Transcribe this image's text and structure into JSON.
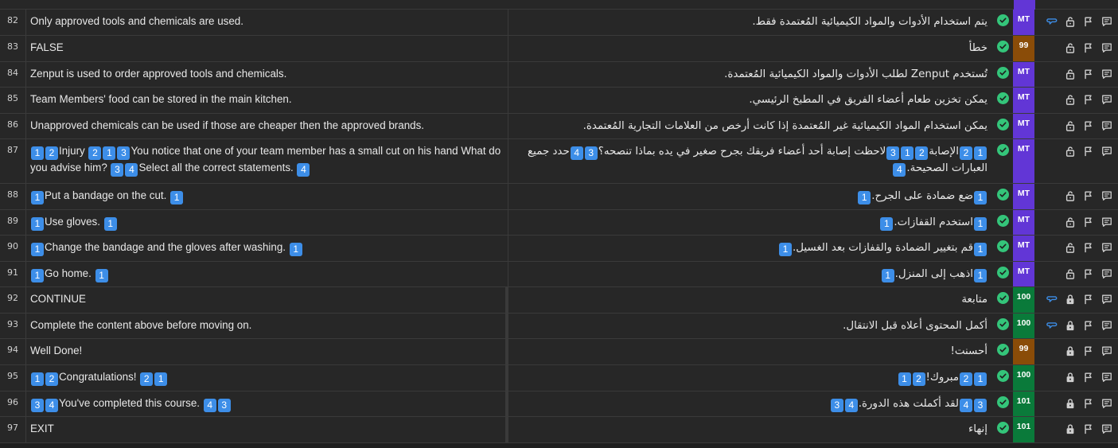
{
  "rows": [
    {
      "num": "82",
      "source": [
        {
          "t": "Only approved tools and chemicals are used."
        }
      ],
      "target": [
        {
          "t": "يتم استخدام الأدوات والمواد الكيميائية المُعتمدة فقط."
        }
      ],
      "badge": "MT",
      "badge_type": "mt",
      "status_icon": "check-circle-icon",
      "icons": [
        "comment-chain-icon",
        "lock-open-icon",
        "flag-icon",
        "comment-icon"
      ],
      "locked": false,
      "link": true
    },
    {
      "num": "83",
      "source": [
        {
          "t": "FALSE"
        }
      ],
      "target": [
        {
          "t": "خطأ"
        }
      ],
      "badge": "99",
      "badge_type": "99",
      "status_icon": "check-circle-icon",
      "icons": [
        "lock-open-icon",
        "flag-icon",
        "comment-icon"
      ],
      "locked": false,
      "link": false
    },
    {
      "num": "84",
      "source": [
        {
          "t": "Zenput is used to order approved tools and chemicals."
        }
      ],
      "target": [
        {
          "t": "تُستخدم Zenput لطلب الأدوات والمواد الكيميائية المُعتمدة."
        }
      ],
      "badge": "MT",
      "badge_type": "mt",
      "status_icon": "check-circle-icon",
      "icons": [
        "lock-open-icon",
        "flag-icon",
        "comment-icon"
      ],
      "locked": false,
      "link": false
    },
    {
      "num": "85",
      "source": [
        {
          "t": "Team Members' food can be stored in the main kitchen."
        }
      ],
      "target": [
        {
          "t": "يمكن تخزين طعام أعضاء الفريق في المطبخ الرئيسي."
        }
      ],
      "badge": "MT",
      "badge_type": "mt",
      "status_icon": "check-circle-icon",
      "icons": [
        "lock-open-icon",
        "flag-icon",
        "comment-icon"
      ],
      "locked": false,
      "link": false
    },
    {
      "num": "86",
      "source": [
        {
          "t": "Unapproved chemicals can be used if those are cheaper then the approved brands."
        }
      ],
      "target": [
        {
          "t": "يمكن استخدام المواد الكيميائية غير المُعتمدة إذا كانت أرخص من العلامات التجارية المُعتمدة."
        }
      ],
      "badge": "MT",
      "badge_type": "mt",
      "status_icon": "check-circle-icon",
      "icons": [
        "lock-open-icon",
        "flag-icon",
        "comment-icon"
      ],
      "locked": false,
      "link": false
    },
    {
      "num": "87",
      "source": [
        {
          "tag": "1"
        },
        {
          "tag": "2"
        },
        {
          "t": "Injury "
        },
        {
          "tag": "2"
        },
        {
          "tag": "1"
        },
        {
          "tag": "3"
        },
        {
          "t": "You notice that one of your team member has a small cut on his hand What do you advise him? "
        },
        {
          "tag": "3"
        },
        {
          "tag": "4"
        },
        {
          "t": "Select all the correct statements. "
        },
        {
          "tag": "4"
        }
      ],
      "target": [
        {
          "tag": "1"
        },
        {
          "tag": "2"
        },
        {
          "t": "الإصابة"
        },
        {
          "tag": "2"
        },
        {
          "tag": "1"
        },
        {
          "tag": "3"
        },
        {
          "t": "لاحظت إصابة أحد أعضاء فريقك بجرح صغير في يده بماذا تنصحه؟"
        },
        {
          "tag": "3"
        },
        {
          "tag": "4"
        },
        {
          "t": "حدد جميع العبارات الصحيحة."
        },
        {
          "tag": "4"
        }
      ],
      "badge": "MT",
      "badge_type": "mt",
      "status_icon": "check-circle-icon",
      "icons": [
        "lock-open-icon",
        "flag-icon",
        "comment-icon"
      ],
      "locked": false,
      "link": false,
      "tall": true
    },
    {
      "num": "88",
      "source": [
        {
          "tag": "1"
        },
        {
          "t": "Put a bandage on the cut. "
        },
        {
          "tag": "1"
        }
      ],
      "target": [
        {
          "tag": "1"
        },
        {
          "t": "ضع ضمادة على الجرح."
        },
        {
          "tag": "1"
        }
      ],
      "badge": "MT",
      "badge_type": "mt",
      "status_icon": "check-circle-icon",
      "icons": [
        "lock-open-icon",
        "flag-icon",
        "comment-icon"
      ],
      "locked": false,
      "link": false
    },
    {
      "num": "89",
      "source": [
        {
          "tag": "1"
        },
        {
          "t": "Use gloves. "
        },
        {
          "tag": "1"
        }
      ],
      "target": [
        {
          "tag": "1"
        },
        {
          "t": "استخدم القفازات."
        },
        {
          "tag": "1"
        }
      ],
      "badge": "MT",
      "badge_type": "mt",
      "status_icon": "check-circle-icon",
      "icons": [
        "lock-open-icon",
        "flag-icon",
        "comment-icon"
      ],
      "locked": false,
      "link": false
    },
    {
      "num": "90",
      "source": [
        {
          "tag": "1"
        },
        {
          "t": "Change the bandage and the gloves after washing. "
        },
        {
          "tag": "1"
        }
      ],
      "target": [
        {
          "tag": "1"
        },
        {
          "t": "قم بتغيير الضمادة والقفازات بعد الغسيل."
        },
        {
          "tag": "1"
        }
      ],
      "badge": "MT",
      "badge_type": "mt",
      "status_icon": "check-circle-icon",
      "icons": [
        "lock-open-icon",
        "flag-icon",
        "comment-icon"
      ],
      "locked": false,
      "link": false
    },
    {
      "num": "91",
      "source": [
        {
          "tag": "1"
        },
        {
          "t": "Go home. "
        },
        {
          "tag": "1"
        }
      ],
      "target": [
        {
          "tag": "1"
        },
        {
          "t": "اذهب إلى المنزل."
        },
        {
          "tag": "1"
        }
      ],
      "badge": "MT",
      "badge_type": "mt",
      "status_icon": "check-circle-icon",
      "icons": [
        "lock-open-icon",
        "flag-icon",
        "comment-icon"
      ],
      "locked": false,
      "link": false
    },
    {
      "num": "92",
      "source": [
        {
          "t": "CONTINUE"
        }
      ],
      "target": [
        {
          "t": "متابعة"
        }
      ],
      "badge": "100",
      "badge_type": "100",
      "status_icon": "check-circle-icon",
      "icons": [
        "comment-chain-icon",
        "lock-icon",
        "flag-icon",
        "comment-icon"
      ],
      "locked": true,
      "link": true,
      "divided": true
    },
    {
      "num": "93",
      "source": [
        {
          "t": "Complete the content above before moving on."
        }
      ],
      "target": [
        {
          "t": "أكمل المحتوى أعلاه قبل الانتقال."
        }
      ],
      "badge": "100",
      "badge_type": "100",
      "status_icon": "check-circle-icon",
      "icons": [
        "comment-chain-icon",
        "lock-icon",
        "flag-icon",
        "comment-icon"
      ],
      "locked": true,
      "link": true,
      "divided": true
    },
    {
      "num": "94",
      "source": [
        {
          "t": "Well Done!"
        }
      ],
      "target": [
        {
          "t": "أحسنت!"
        }
      ],
      "badge": "99",
      "badge_type": "99",
      "status_icon": "check-circle-icon",
      "icons": [
        "lock-icon",
        "flag-icon",
        "comment-icon"
      ],
      "locked": true,
      "link": false,
      "divided": true
    },
    {
      "num": "95",
      "source": [
        {
          "tag": "1"
        },
        {
          "tag": "2"
        },
        {
          "t": "Congratulations! "
        },
        {
          "tag": "2"
        },
        {
          "tag": "1"
        }
      ],
      "target": [
        {
          "tag": "1"
        },
        {
          "tag": "2"
        },
        {
          "t": "مبروك!"
        },
        {
          "tag": "2"
        },
        {
          "tag": "1"
        }
      ],
      "badge": "100",
      "badge_type": "100",
      "status_icon": "check-circle-icon",
      "icons": [
        "lock-icon",
        "flag-icon",
        "comment-icon"
      ],
      "locked": true,
      "link": false,
      "divided": true
    },
    {
      "num": "96",
      "source": [
        {
          "tag": "3"
        },
        {
          "tag": "4"
        },
        {
          "t": "You've completed this course. "
        },
        {
          "tag": "4"
        },
        {
          "tag": "3"
        }
      ],
      "target": [
        {
          "tag": "3"
        },
        {
          "tag": "4"
        },
        {
          "t": "لقد أكملت هذه الدورة."
        },
        {
          "tag": "4"
        },
        {
          "tag": "3"
        }
      ],
      "badge": "101",
      "badge_type": "101",
      "status_icon": "check-circle-icon",
      "icons": [
        "lock-icon",
        "flag-icon",
        "comment-icon"
      ],
      "locked": true,
      "link": false,
      "divided": true
    },
    {
      "num": "97",
      "source": [
        {
          "t": "EXIT"
        }
      ],
      "target": [
        {
          "t": "إنهاء"
        }
      ],
      "badge": "101",
      "badge_type": "101",
      "status_icon": "check-circle-icon",
      "icons": [
        "lock-icon",
        "flag-icon",
        "comment-icon"
      ],
      "locked": true,
      "link": false,
      "divided": true
    }
  ]
}
